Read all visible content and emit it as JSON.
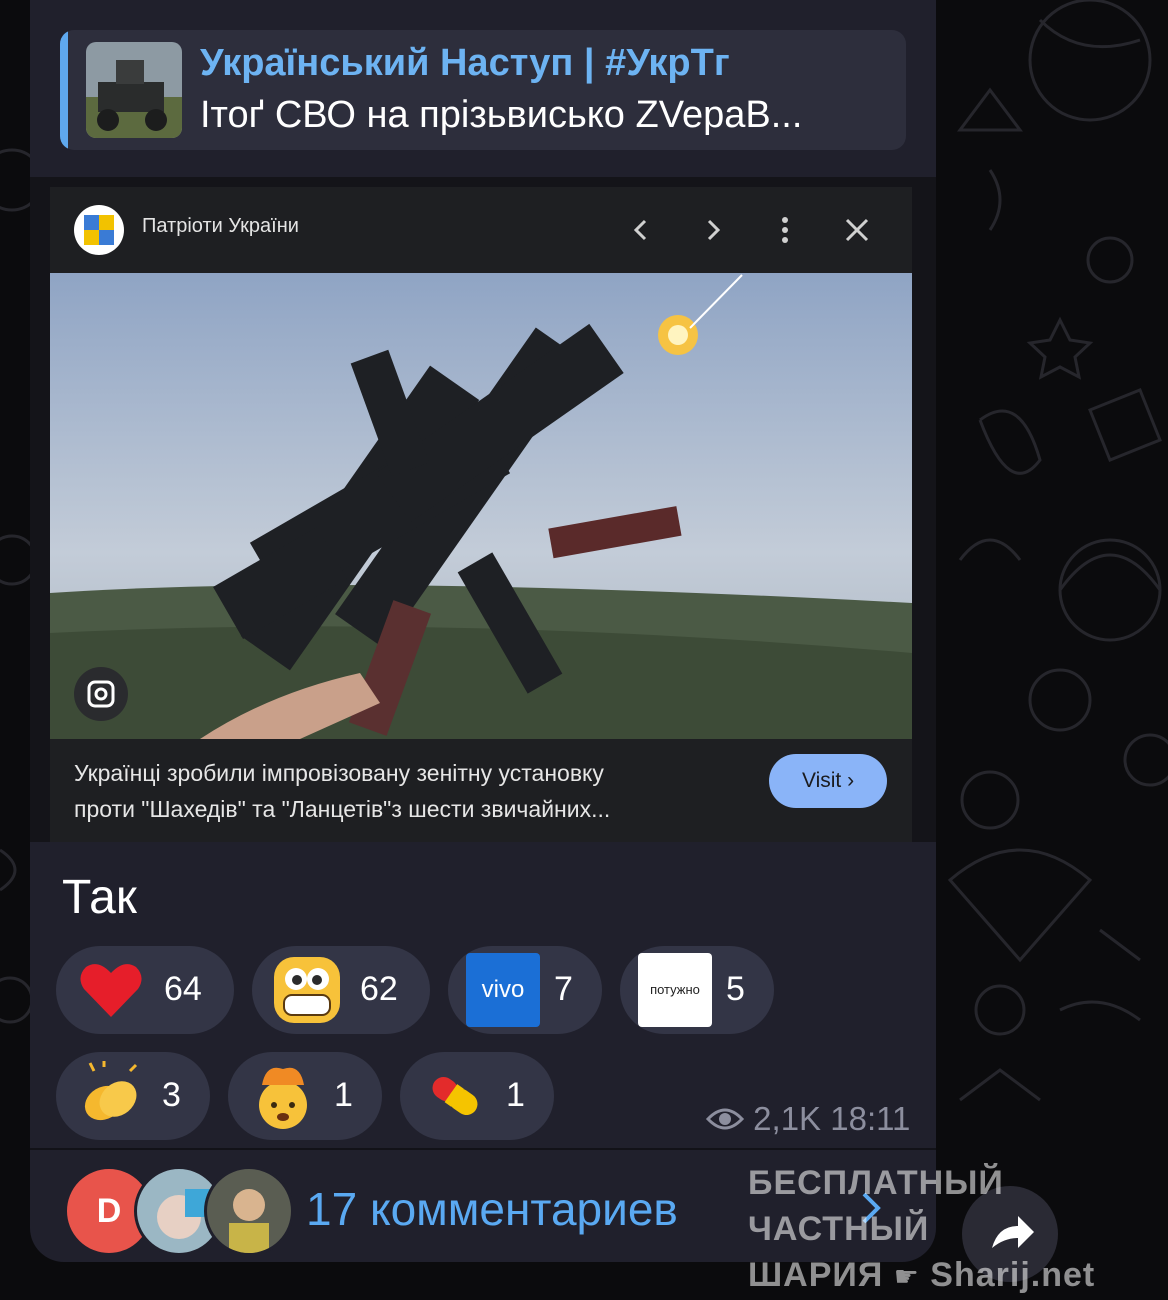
{
  "reply": {
    "channel": "Український Наступ | #УкрТг",
    "preview": "Ітоґ СВО на прізьвисько ZVepaB..."
  },
  "ad": {
    "source": "Патріоти України",
    "description_line1": "Українці зробили імпровізовану зенітну установку",
    "description_line2": "проти \"Шахедів\" та \"Ланцетів\"з шести звичайних...",
    "button": "Visit"
  },
  "message": {
    "text": "Так"
  },
  "reactions": [
    {
      "emoji": "heart-emoji",
      "count": "64"
    },
    {
      "emoji": "grinning-emoji",
      "count": "62"
    },
    {
      "emoji": "vivo-sticker",
      "label": "vivo",
      "count": "7"
    },
    {
      "emoji": "potuzhno-sticker",
      "label": "потужно",
      "count": "5"
    },
    {
      "emoji": "clapping-emoji",
      "count": "3"
    },
    {
      "emoji": "exploding-head-emoji",
      "count": "1"
    },
    {
      "emoji": "pill-emoji",
      "count": "1"
    }
  ],
  "meta": {
    "views": "2,1K",
    "time": "18:11"
  },
  "comments": {
    "avatar_letter": "D",
    "label": "17 комментариев"
  },
  "watermark": {
    "line1": "БЕСПЛАТНЫЙ ЧАСТНЫЙ",
    "line2_a": "ШАРИЯ",
    "line2_b": "Sharij.net"
  },
  "colors": {
    "accent": "#5aa9f2",
    "bubble": "#20202c",
    "chip": "#333546"
  }
}
